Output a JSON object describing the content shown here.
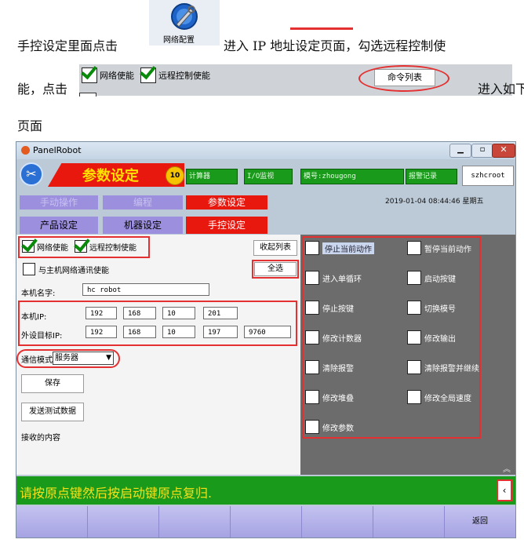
{
  "doc": {
    "line1_prefix": "手控设定里面点击",
    "net_icon_label": "网络配置",
    "line1_suffix": "进入 IP 地址设定页面，勾选远程控制使",
    "line2_prefix": "能，点击",
    "line2_suffix": "进入如下",
    "line3": "页面"
  },
  "toolbar_inset": {
    "net_enable": "网络使能",
    "remote_enable": "远程控制使能",
    "cmd_list_button": "命令列表"
  },
  "window": {
    "title": "PanelRobot",
    "header_title": "参数设定",
    "badge_number": "10",
    "status_cells": [
      "计算器",
      "I/O监视",
      "模号:zhougong",
      "报警记录"
    ],
    "user": "szhcroot",
    "datetime": "2019-01-04  08:44:46  星期五",
    "nav1": [
      "手动操作",
      "编程",
      "参数设定"
    ],
    "nav2": [
      "产品设定",
      "机器设定",
      "手控设定"
    ],
    "left": {
      "net_enable": "网络使能",
      "remote_enable": "远程控制使能",
      "host_comm_enable": "与主机网络通讯使能",
      "name_label": "本机名字:",
      "name_value": "hc robot",
      "ip_label": "本机IP:",
      "ip": [
        "192",
        "168",
        "10",
        "201"
      ],
      "target_label": "外设目标IP:",
      "target_ip": [
        "192",
        "168",
        "10",
        "197"
      ],
      "port": "9760",
      "mode_label": "通信模式",
      "mode_value": "服务器",
      "save_button": "保存",
      "send_test_button": "发送测试数据",
      "received_label": "接收的内容",
      "collapse_button": "收起列表",
      "select_all_button": "全选"
    },
    "commands_left": [
      "停止当前动作",
      "进入单循环",
      "停止按键",
      "修改计数器",
      "清除报警",
      "修改堆叠",
      "修改参数"
    ],
    "commands_right": [
      "暂停当前动作",
      "启动按键",
      "切换模号",
      "修改输出",
      "清除报警并继续",
      "修改全局速度"
    ],
    "message": "请按原点键然后按启动键原点复归.",
    "back_button": "返回"
  },
  "colors": {
    "accent_red": "#e43030",
    "status_green": "#1a9a1a",
    "message_bg": "#1a9a1a",
    "message_text": "#f3e11c",
    "nav_active": "#e8180f",
    "nav_inactive": "#9b8fde"
  }
}
